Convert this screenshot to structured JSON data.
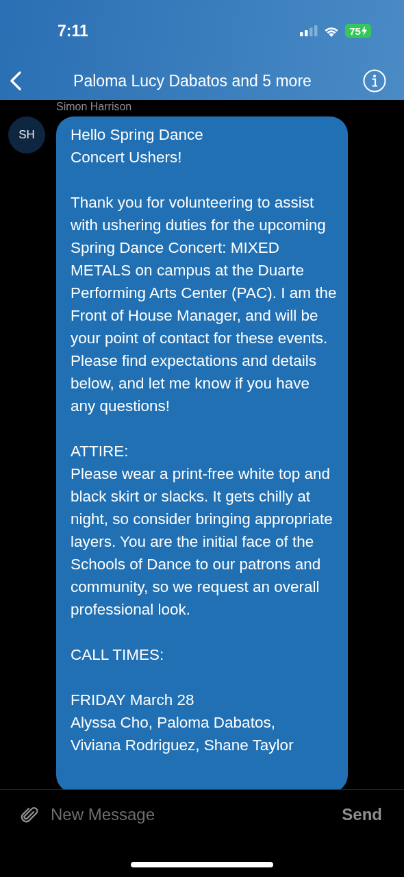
{
  "status_bar": {
    "time": "7:11",
    "battery": "75"
  },
  "nav": {
    "title": "Paloma Lucy Dabatos and 5 more"
  },
  "messages": [
    {
      "sender": "Simon Harrison",
      "initials": "SH",
      "paragraphs": [
        "Hello Spring Dance\nConcert Ushers!",
        "Thank you for volunteering to assist with ushering duties for the upcoming Spring Dance Concert: MIXED METALS on campus at the Duarte Performing Arts Center (PAC). I am the Front of House Manager, and will be your point of contact for these events. Please find expectations and details below, and let me know if you have any questions!",
        "ATTIRE:\nPlease wear a print-free white top and black skirt or slacks. It gets chilly at night, so consider bringing appropriate layers. You are the initial face of the Schools of Dance to our patrons and community, so we request an overall professional look.",
        "CALL TIMES:",
        "FRIDAY March 28\nAlyssa Cho, Paloma Dabatos,\nViviana Rodriguez, Shane Taylor"
      ]
    }
  ],
  "composer": {
    "placeholder": "New Message",
    "send": "Send"
  }
}
